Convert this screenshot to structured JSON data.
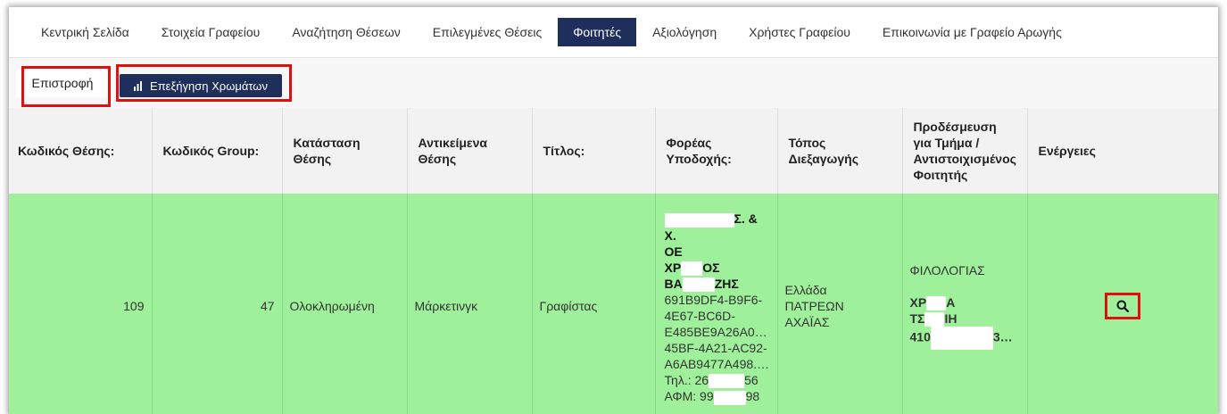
{
  "nav": {
    "items": [
      {
        "label": "Κεντρική Σελίδα",
        "active": false
      },
      {
        "label": "Στοιχεία Γραφείου",
        "active": false
      },
      {
        "label": "Αναζήτηση Θέσεων",
        "active": false
      },
      {
        "label": "Επιλεγμένες Θέσεις",
        "active": false
      },
      {
        "label": "Φοιτητές",
        "active": true
      },
      {
        "label": "Αξιολόγηση",
        "active": false
      },
      {
        "label": "Χρήστες Γραφείου",
        "active": false
      },
      {
        "label": "Επικοινωνία με Γραφείο Αρωγής",
        "active": false
      }
    ]
  },
  "toolbar": {
    "back_label": "Επιστροφή",
    "colors_label": "Επεξήγηση Χρωμάτων",
    "colors_icon": "bar-chart-icon"
  },
  "table": {
    "headers": [
      "Κωδικός Θέσης:",
      "Κωδικός Group:",
      "Κατάσταση Θέσης",
      "Αντικείμενα Θέσης",
      "Τίτλος:",
      "Φορέας Υποδοχής:",
      "Τόπος Διεξαγωγής",
      "Προδέσμευση για Τμήμα / Αντιστοιχισμένος Φοιτητής",
      "Ενέργειες"
    ],
    "row": {
      "position_code": "109",
      "group_code": "47",
      "status": "Ολοκληρωμένη",
      "subject": "Μάρκετινγκ",
      "title": "Γραφίστας",
      "host_line1": "Σ. & Χ.",
      "host_line2": "ΟΕ",
      "host_line3a": "ΧΡ",
      "host_line3b": "ΟΣ",
      "host_line4a": "ΒΑ",
      "host_line4b": "ΖΗΣ",
      "host_id1": "691B9DF4-B9F6-",
      "host_id2": "4E67-BC6D-",
      "host_id3": "E485BE9A26A0…",
      "host_id4": "45BF-4A21-AC92-",
      "host_id5": "A6AB9477A498.…",
      "host_phone_a": "Τηλ.: 26",
      "host_phone_b": "56",
      "host_afm_a": "ΑΦΜ: 99",
      "host_afm_b": "98",
      "location_line1": "Ελλάδα",
      "location_line2": "ΠΑΤΡΕΩΝ",
      "location_line3": "ΑΧΑΪΑΣ",
      "department": "ΦΙΛΟΛΟΓΙΑΣ",
      "student_line1a": "ΧΡ",
      "student_line1b": "Α",
      "student_line2a": "ΤΣ",
      "student_line2b": "ΙΗ",
      "student_line3a": "410",
      "student_line3b": "3…",
      "action_icon": "search-icon"
    }
  },
  "colors": {
    "nav_active": "#1f2f5b",
    "row_bg": "#9ef09a",
    "highlight": "#e01010"
  }
}
